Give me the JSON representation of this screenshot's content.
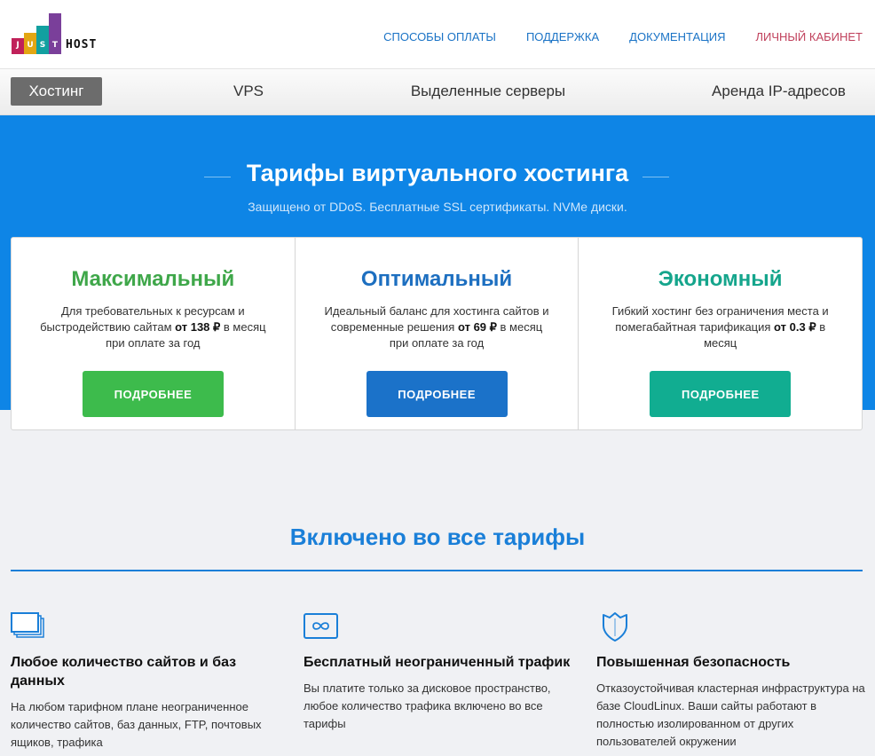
{
  "logo": {
    "letters": [
      "J",
      "U",
      "S",
      "T"
    ],
    "word": "HOST"
  },
  "topnav": {
    "payment": "СПОСОБЫ ОПЛАТЫ",
    "support": "ПОДДЕРЖКА",
    "docs": "ДОКУМЕНТАЦИЯ",
    "cabinet": "ЛИЧНЫЙ КАБИНЕТ"
  },
  "subnav": {
    "hosting": "Хостинг",
    "vps": "VPS",
    "dedicated": "Выделенные серверы",
    "ip": "Аренда IP-адресов"
  },
  "hero": {
    "title": "Тарифы виртуального хостинга",
    "subtitle": "Защищено от DDoS. Бесплатные SSL сертификаты. NVMe диски."
  },
  "plans": [
    {
      "name": "Максимальный",
      "color": "#3fa74a",
      "button_color": "#3dbb4c",
      "desc_pre": "Для требовательных к ресурсам и быстродействию сайтам ",
      "price": "от 138 ₽",
      "desc_post": " в месяц при оплате за год",
      "button": "ПОДРОБНЕЕ"
    },
    {
      "name": "Оптимальный",
      "color": "#1d6fc0",
      "button_color": "#1b72c9",
      "desc_pre": "Идеальный баланс для хостинга сайтов и современные решения ",
      "price": "от 69 ₽",
      "desc_post": " в месяц при оплате за год",
      "button": "ПОДРОБНЕЕ"
    },
    {
      "name": "Экономный",
      "color": "#15a58c",
      "button_color": "#11ad91",
      "desc_pre": "Гибкий хостинг без ограничения места и помегабайтная тарификация ",
      "price": "от 0.3 ₽",
      "desc_post": " в месяц",
      "button": "ПОДРОБНЕЕ"
    }
  ],
  "included": {
    "title": "Включено во все тарифы",
    "features": [
      {
        "icon": "monitors-icon",
        "title": "Любое количество сайтов и баз данных",
        "text": "На любом тарифном плане неограниченное количество сайтов, баз данных, FTP, почтовых ящиков, трафика"
      },
      {
        "icon": "infinity-icon",
        "title": "Бесплатный неограниченный трафик",
        "text": "Вы платите только за дисковое пространство, любое количество трафика включено во все тарифы"
      },
      {
        "icon": "shield-icon",
        "title": "Повышенная безопасность",
        "text": "Отказоустойчивая кластерная инфраструктура на базе CloudLinux. Ваши сайты работают в полностью изолированном от других пользователей окружении"
      }
    ]
  },
  "colors": {
    "brand_blue": "#0e85e6",
    "accent_blue": "#1a7fd8"
  }
}
